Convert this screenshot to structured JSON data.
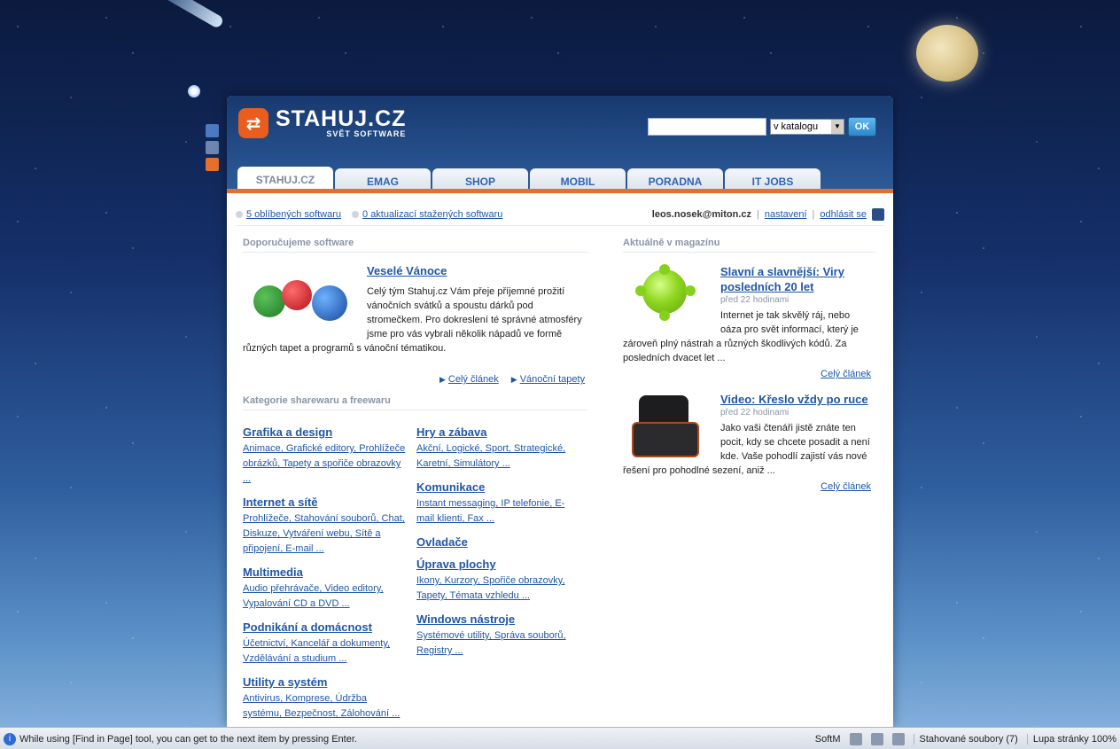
{
  "site": {
    "logo_text": "STAHUJ.CZ",
    "logo_sub": "SVĚT SOFTWARE",
    "search": {
      "placeholder": "",
      "select_value": "v katalogu",
      "ok_label": "OK"
    }
  },
  "tabs": [
    {
      "label": "STAHUJ.CZ"
    },
    {
      "label": "EMAG"
    },
    {
      "label": "SHOP"
    },
    {
      "label": "MOBIL"
    },
    {
      "label": "PORADNA"
    },
    {
      "label": "IT JOBS"
    }
  ],
  "userbar": {
    "favorites": "5 oblíbených softwaru",
    "updates": "0 aktualizací stažených softwaru",
    "email": "leos.nosek@miton.cz",
    "settings": "nastavení",
    "logout": "odhlásit se"
  },
  "featured": {
    "section": "Doporučujeme software",
    "title": "Veselé Vánoce",
    "text": "Celý tým Stahuj.cz Vám přeje příjemné prožití vánočních svátků a spoustu dárků pod stromečkem. Pro dokreslení té správné atmosféry jsme pro vás vybrali několik nápadů ve formě různých tapet a programů s vánoční tématikou.",
    "link_more": "Celý článek",
    "link_all": "Vánoční tapety"
  },
  "categories": {
    "section": "Kategorie sharewaru a freewaru",
    "left": [
      {
        "title": "Grafika a design",
        "subs": "Animace, Grafické editory, Prohlížeče obrázků, Tapety a spořiče obrazovky ..."
      },
      {
        "title": "Internet a sítě",
        "subs": "Prohlížeče, Stahování souborů, Chat, Diskuze, Vytváření webu, Sítě a připojení, E-mail ..."
      },
      {
        "title": "Multimedia",
        "subs": "Audio přehrávače, Video editory, Vypalování CD a DVD ..."
      },
      {
        "title": "Podnikání a domácnost",
        "subs": "Účetnictví, Kancelář a dokumenty, Vzdělávání a studium ..."
      },
      {
        "title": "Utility a systém",
        "subs": "Antivirus, Komprese, Údržba systému, Bezpečnost, Zálohování ..."
      }
    ],
    "right": [
      {
        "title": "Hry a zábava",
        "subs": "Akční, Logické, Sport, Strategické, Karetní, Simulátory ..."
      },
      {
        "title": "Komunikace",
        "subs": "Instant messaging, IP telefonie, E-mail klienti, Fax ..."
      },
      {
        "title": "Ovladače",
        "subs": ""
      },
      {
        "title": "Úprava plochy",
        "subs": "Ikony, Kurzory, Spořiče obrazovky, Tapety, Témata vzhledu ..."
      },
      {
        "title": "Windows nástroje",
        "subs": "Systémové utility, Správa souborů, Registry ..."
      }
    ]
  },
  "magazine": {
    "section": "Aktuálně v magazínu",
    "articles": [
      {
        "title": "Slavní a slavnější: Viry posledních 20 let",
        "time": "před 22 hodinami",
        "text": "Internet je tak skvělý ráj, nebo oáza pro svět informací, který je zároveň plný nástrah a různých škodlivých kódů. Za posledních dvacet let ...",
        "link": "Celý článek"
      },
      {
        "title": "Video: Křeslo vždy po ruce",
        "time": "před 22 hodinami",
        "text": "Jako vaši čtenáři jistě znáte ten pocit, kdy se chcete posadit a není kde. Vaše pohodlí zajistí vás nové řešení pro pohodlné sezení, aniž ...",
        "link": "Celý článek"
      }
    ]
  },
  "statusbar": {
    "message": "While using [Find in Page] tool, you can get to the next item by pressing Enter.",
    "mode": "SoftM",
    "downloads": "Stahované soubory (7)",
    "zoom": "Lupa stránky 100%"
  },
  "colors": {
    "accent": "#e5702d",
    "link": "#1f57a8",
    "header": "#27528e"
  }
}
